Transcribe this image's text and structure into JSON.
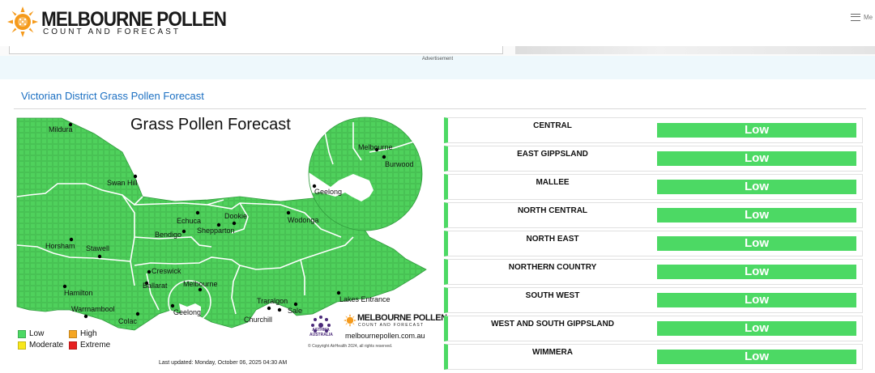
{
  "header": {
    "logo_title": "MELBOURNE POLLEN",
    "logo_subtitle": "COUNT AND FORECAST",
    "menu_label": "Me"
  },
  "ad": {
    "label": "Advertisement"
  },
  "section": {
    "title": "Victorian District Grass Pollen Forecast"
  },
  "map": {
    "title": "Grass Pollen Forecast",
    "towns": [
      "Mildura",
      "Swan Hill",
      "Echuca",
      "Dookie",
      "Shepparton",
      "Wodonga",
      "Bendigo",
      "Horsham",
      "Stawell",
      "Creswick",
      "Ballarat",
      "Melbourne",
      "Hamilton",
      "Warrnambool",
      "Colac",
      "Geelong",
      "Traralgon",
      "Sale",
      "Churchill",
      "Lakes Entrance"
    ],
    "inset_towns": [
      "Melbourne",
      "Burwood",
      "Geelong"
    ],
    "legend": [
      {
        "label": "Low",
        "color": "#4cd964"
      },
      {
        "label": "High",
        "color": "#f5a623"
      },
      {
        "label": "Moderate",
        "color": "#f8e71c"
      },
      {
        "label": "Extreme",
        "color": "#e62020"
      }
    ],
    "asthma_logo_text": [
      "ASTHMA",
      "AUSTRALIA"
    ],
    "brand_title": "MELBOURNE POLLEN",
    "brand_subtitle": "COUNT AND FORECAST",
    "url": "melbournepollen.com.au",
    "copyright": "© Copyright AirHealth 2024, all rights reserved.",
    "last_updated": "Last updated: Monday, October 06, 2025 04:30 AM"
  },
  "colors": {
    "low": "#4cd964",
    "map_fill": "#4fd15c",
    "map_tile": "#43b84f",
    "accent_blue": "#1b6fc2"
  },
  "districts": [
    {
      "name": "CENTRAL",
      "level": "Low"
    },
    {
      "name": "EAST GIPPSLAND",
      "level": "Low"
    },
    {
      "name": "MALLEE",
      "level": "Low"
    },
    {
      "name": "NORTH CENTRAL",
      "level": "Low"
    },
    {
      "name": "NORTH EAST",
      "level": "Low"
    },
    {
      "name": "NORTHERN COUNTRY",
      "level": "Low"
    },
    {
      "name": "SOUTH WEST",
      "level": "Low"
    },
    {
      "name": "WEST AND SOUTH GIPPSLAND",
      "level": "Low"
    },
    {
      "name": "WIMMERA",
      "level": "Low"
    }
  ]
}
